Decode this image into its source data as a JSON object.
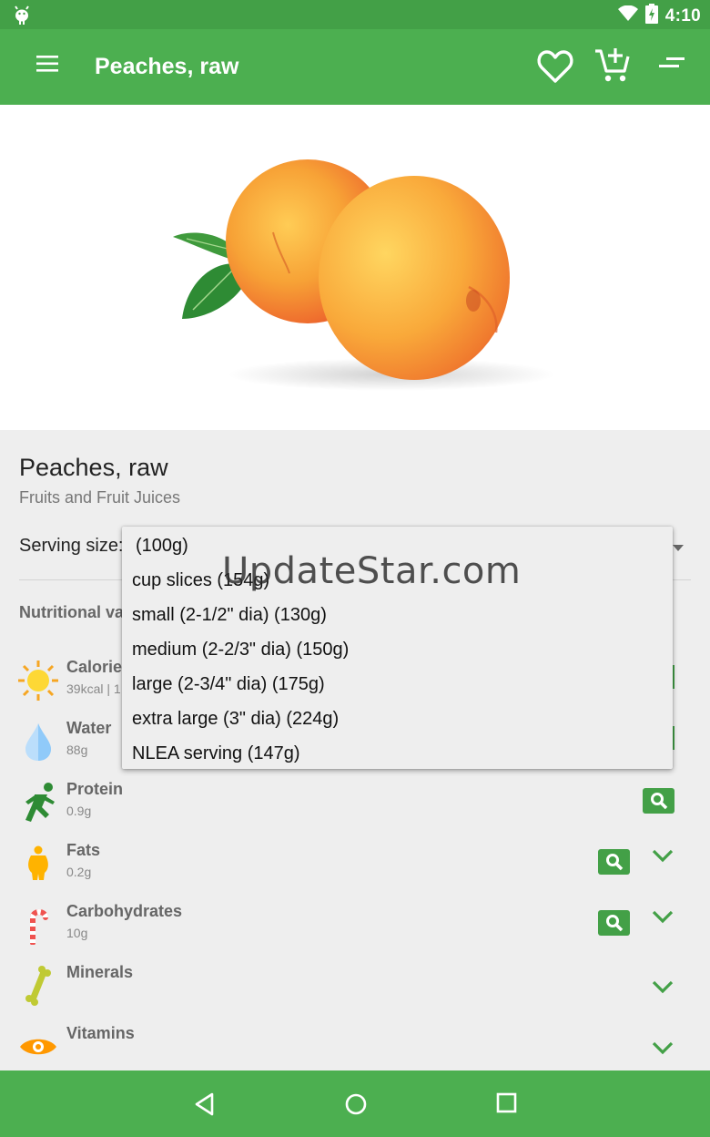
{
  "status_bar": {
    "time": "4:10",
    "icons": [
      "android-icon",
      "wifi-icon",
      "battery-icon"
    ]
  },
  "app_bar": {
    "title": "Peaches, raw",
    "icons": [
      "menu-icon",
      "heart-icon",
      "add-to-cart-icon",
      "sort-icon"
    ]
  },
  "food": {
    "name": "Peaches, raw",
    "category": "Fruits and Fruit Juices",
    "serving_label": "Serving size:"
  },
  "nutrition": {
    "heading": "Nutritional va",
    "rows": [
      {
        "name": "Calories",
        "value": "39kcal | 1",
        "icon": "sun-icon"
      },
      {
        "name": "Water",
        "value": "88g",
        "icon": "water-drop-icon"
      },
      {
        "name": "Protein",
        "value": "0.9g",
        "icon": "running-person-icon"
      },
      {
        "name": "Fats",
        "value": "0.2g",
        "icon": "body-icon"
      },
      {
        "name": "Carbohydrates",
        "value": "10g",
        "icon": "candy-cane-icon"
      },
      {
        "name": "Minerals",
        "value": "",
        "icon": "bone-icon"
      },
      {
        "name": "Vitamins",
        "value": "",
        "icon": "eye-icon"
      }
    ]
  },
  "serving_dropdown": {
    "options": [
      "(100g)",
      "cup slices (154g)",
      "small (2-1/2\" dia) (130g)",
      "medium (2-2/3\" dia) (150g)",
      "large (2-3/4\" dia) (175g)",
      "extra large (3\" dia) (224g)",
      "NLEA serving (147g)"
    ]
  },
  "watermark": "UpdateStar.com",
  "colors": {
    "primary": "#4caf50",
    "primary_dark": "#43a047",
    "background": "#eeeeee"
  }
}
